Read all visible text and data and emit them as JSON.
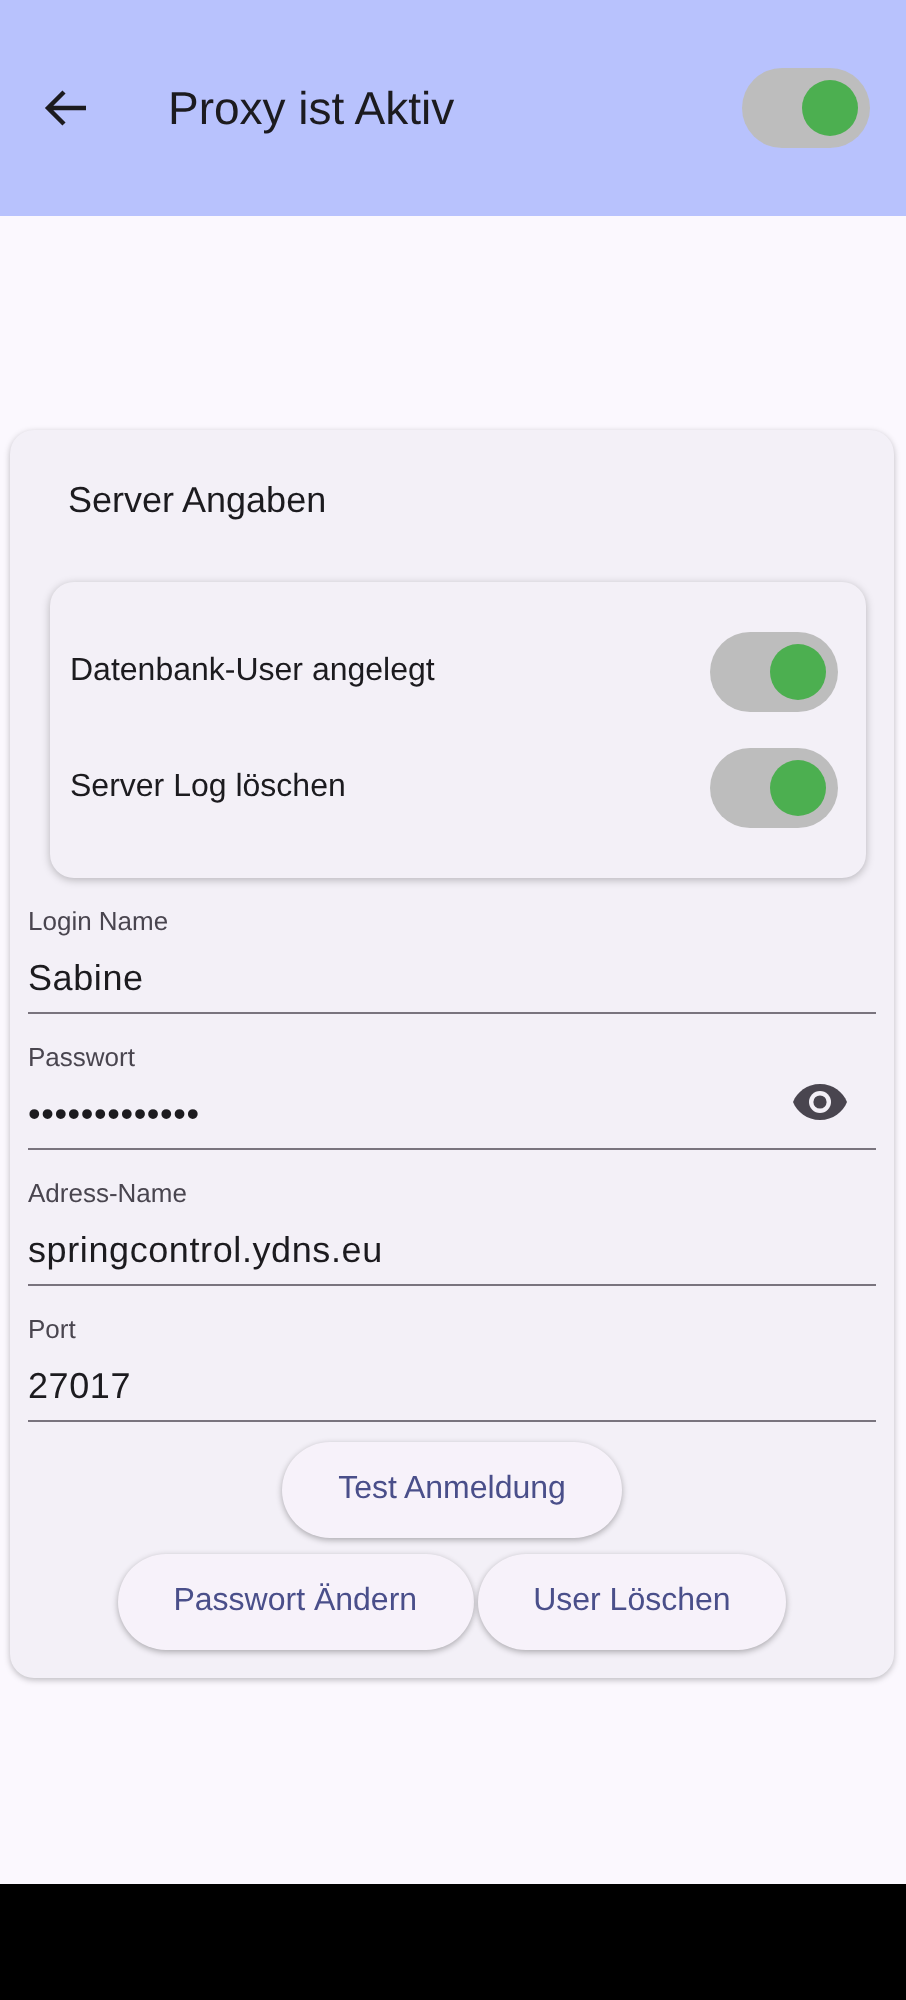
{
  "app_bar": {
    "title": "Proxy ist Aktiv",
    "switch_on": true
  },
  "card": {
    "title": "Server Angaben",
    "switches": [
      {
        "label": "Datenbank-User angelegt",
        "on": true
      },
      {
        "label": "Server Log löschen",
        "on": true
      }
    ],
    "fields": [
      {
        "label": "Login Name",
        "value": "Sabine",
        "kind": "text"
      },
      {
        "label": "Passwort",
        "value": "•••••••••••••",
        "kind": "password"
      },
      {
        "label": "Adress-Name",
        "value": "springcontrol.ydns.eu",
        "kind": "text"
      },
      {
        "label": "Port",
        "value": "27017",
        "kind": "text"
      }
    ],
    "button_rows": [
      [
        "Test Anmeldung"
      ],
      [
        "Passwort Ändern",
        "User Löschen"
      ]
    ]
  }
}
